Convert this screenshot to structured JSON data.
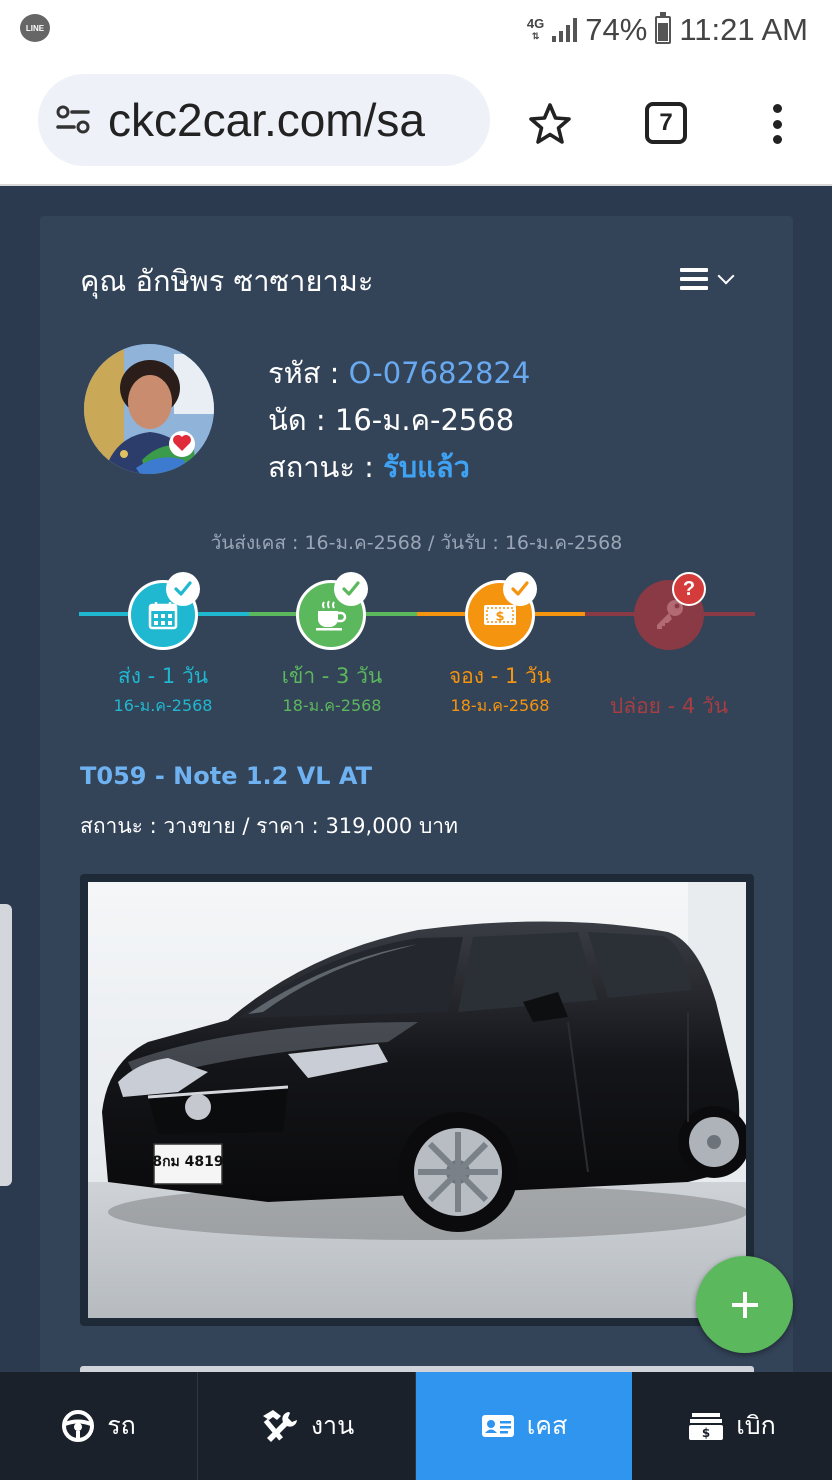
{
  "status_bar": {
    "app_badge": "LINE",
    "network": "4G",
    "battery": "74%",
    "time": "11:21 AM",
    "battery_level": 0.74
  },
  "browser": {
    "url": "ckc2car.com/sa",
    "tab_count": "7",
    "icons": [
      "tune-icon",
      "star-icon",
      "tabs-icon",
      "more-vert-icon"
    ]
  },
  "customer": {
    "name": "คุณ อักษิพร ซาซายามะ",
    "code_label": "รหัส : ",
    "code": "O-07682824",
    "appt_label": "นัด : ",
    "appt": "16-ม.ค-2568",
    "status_label": "สถานะ : ",
    "status": "รับแล้ว"
  },
  "case_dates": "วันส่งเคส : 16-ม.ค-2568 / วันรับ : 16-ม.ค-2568",
  "timeline": [
    {
      "label": "ส่ง - 1 วัน",
      "date": "16-ม.ค-2568",
      "color": "#1fb8d0",
      "icon": "calendar-icon",
      "done": true
    },
    {
      "label": "เข้า - 3 วัน",
      "date": "18-ม.ค-2568",
      "color": "#5cb85c",
      "icon": "coffee-icon",
      "done": true
    },
    {
      "label": "จอง - 1 วัน",
      "date": "18-ม.ค-2568",
      "color": "#f5940e",
      "icon": "money-icon",
      "done": true
    },
    {
      "label": "ปล่อย - 4 วัน",
      "date": "",
      "color": "#b33a3a",
      "icon": "key-icon",
      "done": false
    }
  ],
  "car": {
    "title": "T059 - Note 1.2 VL AT",
    "status_line": "สถานะ : วางขาย / ราคา : 319,000 บาท",
    "plate": "8กม 4819"
  },
  "fab_icon": "plus-icon",
  "bottom_nav": [
    {
      "label": "รถ",
      "icon": "steering-wheel-icon"
    },
    {
      "label": "งาน",
      "icon": "tools-icon"
    },
    {
      "label": "เคส",
      "icon": "id-card-icon",
      "active": true
    },
    {
      "label": "เบิก",
      "icon": "cash-icon"
    }
  ]
}
